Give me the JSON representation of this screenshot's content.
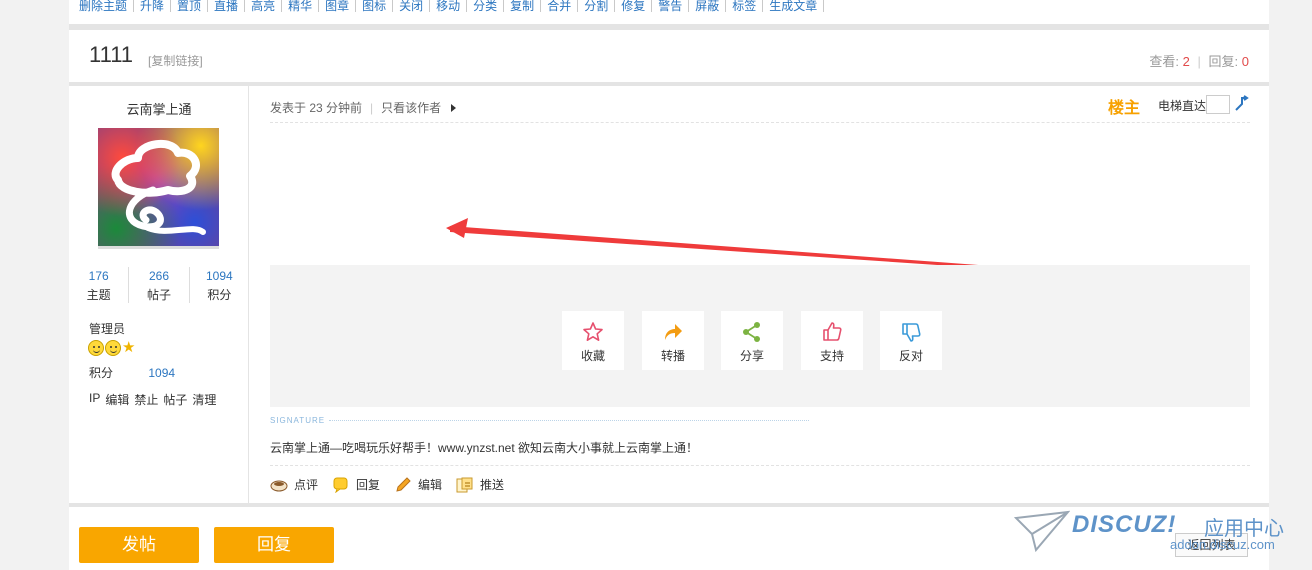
{
  "admin_bar": {
    "items": [
      "删除主题",
      "升降",
      "置顶",
      "直播",
      "高亮",
      "精华",
      "图章",
      "图标",
      "关闭",
      "移动",
      "分类",
      "复制",
      "合并",
      "分割",
      "修复",
      "警告",
      "屏蔽",
      "标签",
      "生成文章"
    ]
  },
  "thread": {
    "title": "1111",
    "copy_link": "[复制链接]",
    "views_label": "查看:",
    "views": "2",
    "replies_label": "回复:",
    "replies": "0"
  },
  "author": {
    "name": "云南掌上通",
    "stats": [
      {
        "value": "176",
        "label": "主题"
      },
      {
        "value": "266",
        "label": "帖子"
      },
      {
        "value": "1094",
        "label": "积分"
      }
    ],
    "role": "管理员",
    "score_label": "积分",
    "score_value": "1094",
    "admin_links": [
      "IP",
      "编辑",
      "禁止",
      "帖子",
      "清理"
    ]
  },
  "post": {
    "posted": "发表于 23 分钟前",
    "only_author": "只看该作者",
    "floor_label": "楼主",
    "elevator_label": "电梯直达",
    "actions": [
      {
        "label": "收藏",
        "icon": "star-outline-icon",
        "color": "#e6506e"
      },
      {
        "label": "转播",
        "icon": "forward-arrow-icon",
        "color": "#f39c12"
      },
      {
        "label": "分享",
        "icon": "share-icon",
        "color": "#7cb342"
      },
      {
        "label": "支持",
        "icon": "thumbs-up-icon",
        "color": "#e6506e"
      },
      {
        "label": "反对",
        "icon": "thumbs-down-icon",
        "color": "#3a9ad9"
      }
    ],
    "signature_label": "SIGNATURE",
    "signature_text": "云南掌上通—吃喝玩乐好帮手！www.ynzst.net 欲知云南大小事就上云南掌上通！",
    "tools": [
      {
        "label": "点评",
        "icon": "coffee-cup-icon"
      },
      {
        "label": "回复",
        "icon": "speech-bubble-icon"
      },
      {
        "label": "编辑",
        "icon": "pencil-icon"
      },
      {
        "label": "推送",
        "icon": "push-icon"
      }
    ]
  },
  "bottom": {
    "new_post": "发帖",
    "reply": "回复",
    "back_list": "返回列表"
  },
  "watermark": {
    "brand": "DISCUZ!",
    "brand_cn": "应用中心",
    "url": "addon.discuz.com"
  },
  "colors": {
    "link": "#2c76c0",
    "accent": "#f9a600",
    "red": "#e24b4b"
  }
}
